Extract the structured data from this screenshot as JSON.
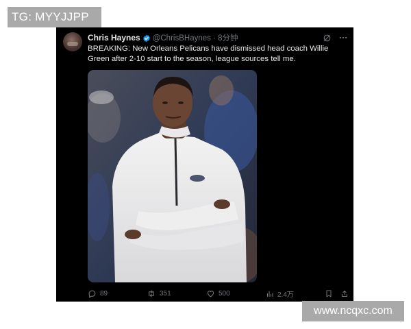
{
  "watermarks": {
    "top_left": "TG: MYYJJPP",
    "bottom_right": "www.ncqxc.com"
  },
  "tweet": {
    "author_name": "Chris Haynes",
    "verified": true,
    "handle_time": "@ChrisBHaynes · 8分钟",
    "text": "BREAKING: New Orleans Pelicans have dismissed head coach Willie Green after 2-10 start to the season, league sources tell me.",
    "media_alt_icon": "photo-coach-arms-crossed",
    "actions": {
      "replies": "89",
      "retweets": "351",
      "likes": "500",
      "views": "2.4万"
    }
  },
  "colors": {
    "tweet_background": "#000000",
    "primary_text": "#e7e9ea",
    "secondary_text": "#71767b",
    "verified_badge": "#1d9bf0",
    "watermark_background": "#a9a9a9"
  }
}
